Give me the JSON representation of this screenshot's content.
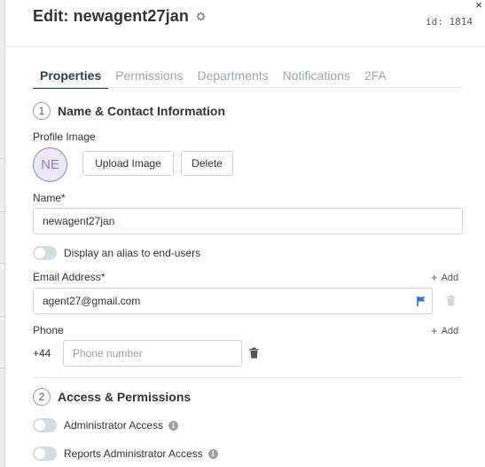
{
  "header": {
    "title": "Edit: newagent27jan",
    "id_label": "id: 1814",
    "close_glyph": "×"
  },
  "tabs": [
    {
      "label": "Properties",
      "active": true
    },
    {
      "label": "Permissions",
      "active": false
    },
    {
      "label": "Departments",
      "active": false
    },
    {
      "label": "Notifications",
      "active": false
    },
    {
      "label": "2FA",
      "active": false
    }
  ],
  "sections": {
    "contact": {
      "number": "1",
      "title": "Name & Contact Information"
    },
    "access": {
      "number": "2",
      "title": "Access & Permissions"
    }
  },
  "profile_image": {
    "label": "Profile Image",
    "initials": "NE",
    "upload_label": "Upload Image",
    "delete_label": "Delete"
  },
  "name": {
    "label": "Name*",
    "value": "newagent27jan"
  },
  "alias_toggle": {
    "label": "Display an alias to end-users",
    "on": false
  },
  "email": {
    "label": "Email Address*",
    "value": "agent27@gmail.com",
    "add_label": "Add"
  },
  "phone": {
    "label": "Phone",
    "country_code": "+44",
    "placeholder": "Phone number",
    "add_label": "Add"
  },
  "access": {
    "admin_label": "Administrator Access",
    "reports_admin_label": "Reports Administrator Access"
  },
  "colors": {
    "accent": "#2d3e50",
    "avatar": "#8e7cc3",
    "flag": "#2f6fd0",
    "muted_tab": "#a0a5ab"
  },
  "icons": [
    "gear-icon",
    "flag-icon",
    "trash-icon",
    "plus-icon",
    "info-icon",
    "close-icon"
  ]
}
